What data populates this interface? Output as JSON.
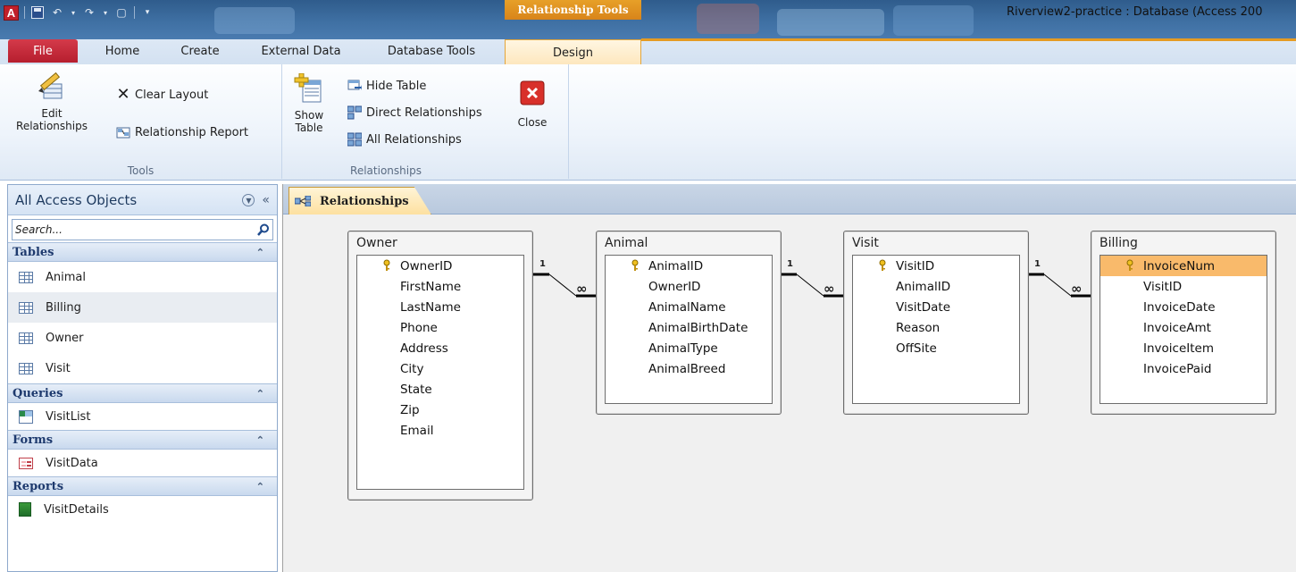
{
  "app": {
    "window_title": "Riverview2-practice : Database (Access 200",
    "contextual_header": "Relationship Tools"
  },
  "tabs": [
    {
      "label": "File"
    },
    {
      "label": "Home"
    },
    {
      "label": "Create"
    },
    {
      "label": "External Data"
    },
    {
      "label": "Database Tools"
    },
    {
      "label": "Design"
    }
  ],
  "ribbon": {
    "tools": {
      "edit_relationships": "Edit\nRelationships",
      "clear_layout": "Clear Layout",
      "relationship_report": "Relationship Report",
      "group_label": "Tools"
    },
    "relationships": {
      "show_table": "Show\nTable",
      "hide_table": "Hide Table",
      "direct_relationships": "Direct Relationships",
      "all_relationships": "All Relationships",
      "close": "Close",
      "group_label": "Relationships"
    }
  },
  "nav": {
    "header": "All Access Objects",
    "search_placeholder": "Search...",
    "sections": [
      {
        "title": "Tables",
        "items": [
          "Animal",
          "Billing",
          "Owner",
          "Visit"
        ]
      },
      {
        "title": "Queries",
        "items": [
          "VisitList"
        ]
      },
      {
        "title": "Forms",
        "items": [
          "VisitData"
        ]
      },
      {
        "title": "Reports",
        "items": [
          "VisitDetails"
        ]
      }
    ]
  },
  "document": {
    "tab_label": "Relationships"
  },
  "relationship_tables": [
    {
      "name": "Owner",
      "fields": [
        "OwnerID",
        "FirstName",
        "LastName",
        "Phone",
        "Address",
        "City",
        "State",
        "Zip",
        "Email"
      ],
      "key": "OwnerID"
    },
    {
      "name": "Animal",
      "fields": [
        "AnimalID",
        "OwnerID",
        "AnimalName",
        "AnimalBirthDate",
        "AnimalType",
        "AnimalBreed"
      ],
      "key": "AnimalID"
    },
    {
      "name": "Visit",
      "fields": [
        "VisitID",
        "AnimalID",
        "VisitDate",
        "Reason",
        "OffSite"
      ],
      "key": "VisitID"
    },
    {
      "name": "Billing",
      "fields": [
        "InvoiceNum",
        "VisitID",
        "InvoiceDate",
        "InvoiceAmt",
        "InvoiceItem",
        "InvoicePaid"
      ],
      "key": "InvoiceNum",
      "selected": "InvoiceNum"
    }
  ],
  "relationship_labels": {
    "one": "1",
    "many": "∞"
  },
  "colors": {
    "file_tab": "#c42b3b",
    "contextual": "#e09a25",
    "selected_field": "#f9ba6b"
  }
}
